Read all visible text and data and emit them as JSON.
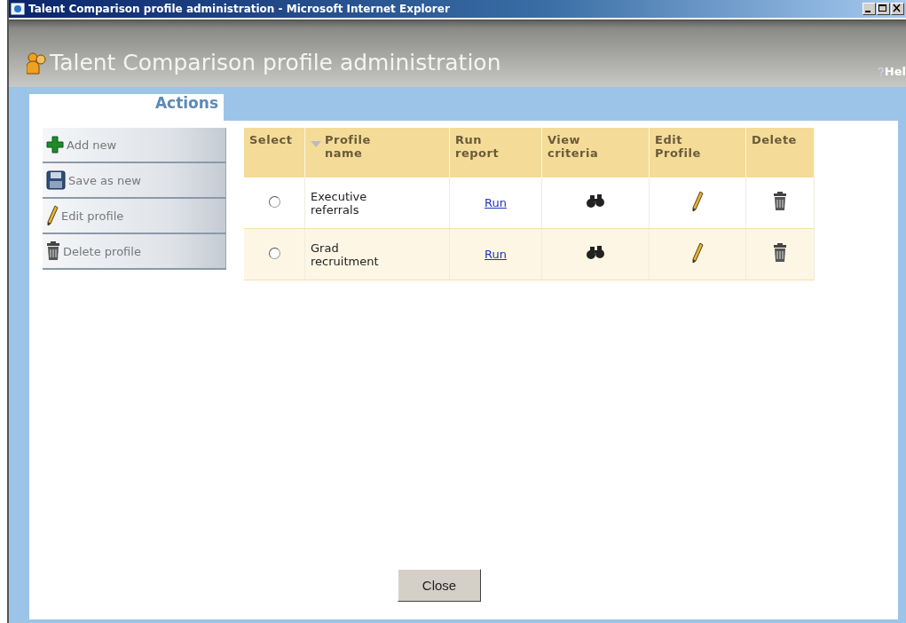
{
  "window": {
    "title": "Talent Comparison profile administration - Microsoft Internet Explorer"
  },
  "header": {
    "title": "Talent Comparison profile administration",
    "help": "Hel"
  },
  "actions": {
    "title": "Actions",
    "items": [
      {
        "kind": "add",
        "label": "Add new"
      },
      {
        "kind": "save",
        "label": "Save as new"
      },
      {
        "kind": "edit",
        "label": "Edit profile"
      },
      {
        "kind": "delete",
        "label": "Delete profile"
      }
    ]
  },
  "table": {
    "columns": [
      {
        "label": "Select",
        "sorted": false
      },
      {
        "label": "Profile name",
        "sorted": true
      },
      {
        "label": "Run report",
        "sorted": false
      },
      {
        "label": "View criteria",
        "sorted": false
      },
      {
        "label": "Edit Profile",
        "sorted": false
      },
      {
        "label": "Delete",
        "sorted": false
      }
    ],
    "rows": [
      {
        "selected": false,
        "name": "Executive referrals",
        "run": "Run"
      },
      {
        "selected": false,
        "name": "Grad recruitment",
        "run": "Run"
      }
    ]
  },
  "close_button": "Close"
}
